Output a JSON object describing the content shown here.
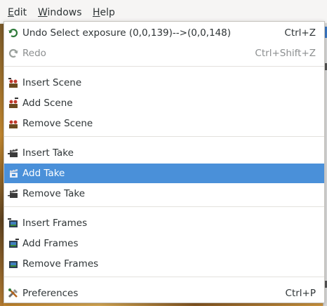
{
  "menubar": {
    "edit": {
      "pre": "",
      "mnemonic": "E",
      "post": "dit"
    },
    "windows": {
      "pre": "",
      "mnemonic": "W",
      "post": "indows"
    },
    "help": {
      "pre": "",
      "mnemonic": "H",
      "post": "elp"
    }
  },
  "edit_menu": {
    "undo": {
      "label": "Undo Select exposure (0,0,139)-->(0,0,148)",
      "accel": "Ctrl+Z",
      "icon": "undo-icon"
    },
    "redo": {
      "label": "Redo",
      "accel": "Ctrl+Shift+Z",
      "icon": "redo-icon",
      "disabled": true
    },
    "insert_scene": {
      "label": "Insert Scene",
      "icon": "insert-scene-icon"
    },
    "add_scene": {
      "label": "Add Scene",
      "icon": "add-scene-icon"
    },
    "remove_scene": {
      "label": "Remove Scene",
      "icon": "remove-scene-icon"
    },
    "insert_take": {
      "label": "Insert Take",
      "icon": "insert-take-icon"
    },
    "add_take": {
      "label": "Add Take",
      "icon": "add-take-icon",
      "highlighted": true
    },
    "remove_take": {
      "label": "Remove Take",
      "icon": "remove-take-icon"
    },
    "insert_frames": {
      "label": "Insert Frames",
      "icon": "insert-frames-icon"
    },
    "add_frames": {
      "label": "Add Frames",
      "icon": "add-frames-icon"
    },
    "remove_frames": {
      "label": "Remove Frames",
      "icon": "remove-frames-icon"
    },
    "preferences": {
      "label": "Preferences",
      "accel": "Ctrl+P",
      "icon": "preferences-icon"
    }
  },
  "colors": {
    "highlight": "#4a90d9",
    "disabled_text": "#8b8e8f"
  }
}
